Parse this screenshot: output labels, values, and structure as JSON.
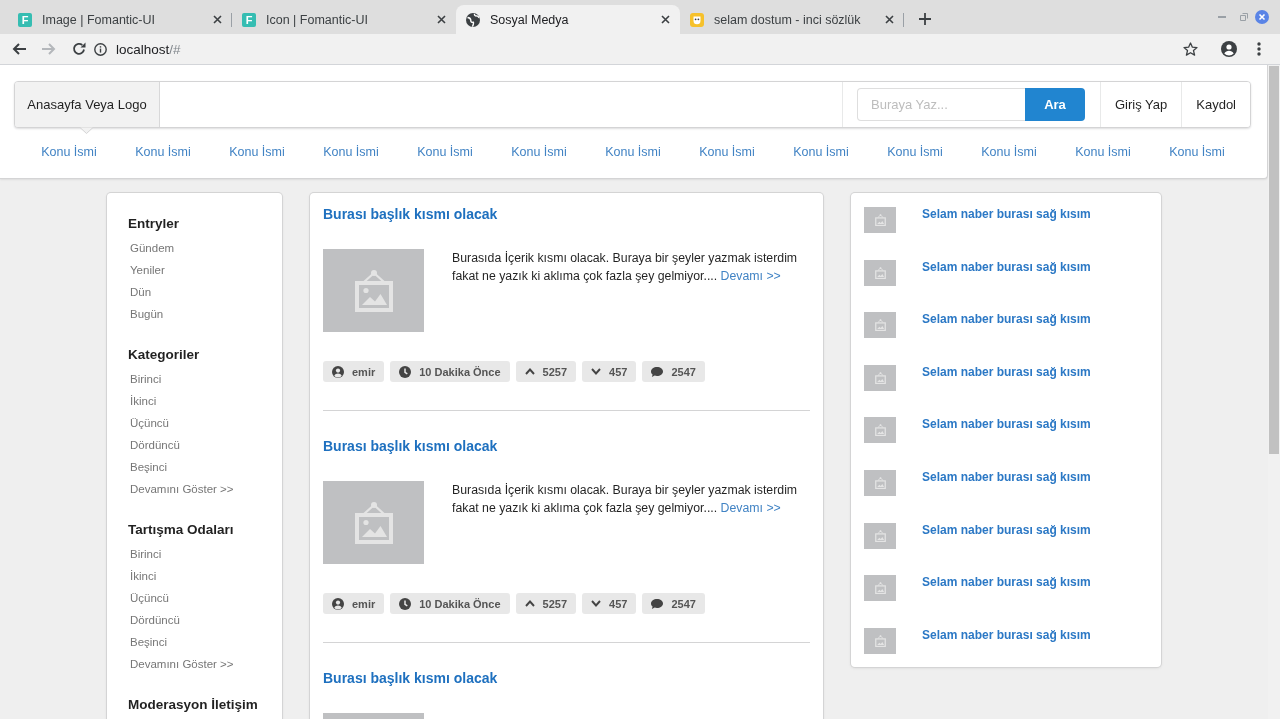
{
  "browser": {
    "tabs": [
      {
        "title": "Image | Fomantic-UI",
        "icon": {
          "kind": "letter",
          "text": "F"
        },
        "selected": false
      },
      {
        "title": "Icon | Fomantic-UI",
        "icon": {
          "kind": "letter",
          "text": "F"
        },
        "selected": false
      },
      {
        "title": "Sosyal Medya",
        "icon": {
          "kind": "globe"
        },
        "selected": true
      },
      {
        "title": "selam dostum - inci sözlük",
        "icon": {
          "kind": "tile"
        },
        "selected": false
      }
    ],
    "toolbar": {
      "back": {
        "disabled": false
      },
      "forward": {
        "disabled": true
      },
      "address": {
        "host": "localhost",
        "path": "/#"
      }
    }
  },
  "menu": {
    "home": {
      "label": "Anasayfa Veya Logo",
      "selected": true
    },
    "search": {
      "placeholder": "Buraya Yaz...",
      "button": "Ara"
    },
    "items": [
      {
        "label": "Giriş Yap",
        "selected": false
      },
      {
        "label": "Kaydol",
        "selected": false
      }
    ]
  },
  "topics": [
    {
      "label": "Konu İsmi"
    },
    {
      "label": "Konu İsmi"
    },
    {
      "label": "Konu İsmi"
    },
    {
      "label": "Konu İsmi"
    },
    {
      "label": "Konu İsmi"
    },
    {
      "label": "Konu İsmi"
    },
    {
      "label": "Konu İsmi"
    },
    {
      "label": "Konu İsmi"
    },
    {
      "label": "Konu İsmi"
    },
    {
      "label": "Konu İsmi"
    },
    {
      "label": "Konu İsmi"
    },
    {
      "label": "Konu İsmi"
    },
    {
      "label": "Konu İsmi"
    }
  ],
  "sidebar": {
    "sections": [
      {
        "title": "Entryler",
        "items": [
          "Gündem",
          "Yeniler",
          "Dün",
          "Bugün"
        ]
      },
      {
        "title": "Kategoriler",
        "items": [
          "Birinci",
          "İkinci",
          "Üçüncü",
          "Dördüncü",
          "Beşinci",
          "Devamını Göster >>"
        ]
      },
      {
        "title": "Tartışma Odaları",
        "items": [
          "Birinci",
          "İkinci",
          "Üçüncü",
          "Dördüncü",
          "Beşinci",
          "Devamını Göster >>"
        ]
      },
      {
        "title": "Moderasyon İletişim"
      }
    ]
  },
  "posts": [
    {
      "title": "Burası başlık kısmı olacak",
      "body": "Burasıda İçerik kısmı olacak. Buraya bir şeyler yazmak isterdim fakat ne yazık ki aklıma çok fazla şey gelmiyor....",
      "more": "Devamı >>",
      "meta": [
        {
          "kind": "author",
          "text": "emir"
        },
        {
          "kind": "time",
          "text": "10 Dakika Önce"
        },
        {
          "kind": "upvotes",
          "text": "5257"
        },
        {
          "kind": "downvotes",
          "text": "457"
        },
        {
          "kind": "comments",
          "text": "2547"
        }
      ]
    },
    {
      "title": "Burası başlık kısmı olacak",
      "body": "Burasıda İçerik kısmı olacak. Buraya bir şeyler yazmak isterdim fakat ne yazık ki aklıma çok fazla şey gelmiyor....",
      "more": "Devamı >>",
      "meta": [
        {
          "kind": "author",
          "text": "emir"
        },
        {
          "kind": "time",
          "text": "10 Dakika Önce"
        },
        {
          "kind": "upvotes",
          "text": "5257"
        },
        {
          "kind": "downvotes",
          "text": "457"
        },
        {
          "kind": "comments",
          "text": "2547"
        }
      ]
    },
    {
      "title": "Burası başlık kısmı olacak"
    }
  ],
  "right_panel": {
    "items": [
      {
        "title": "Selam naber burası sağ kısım"
      },
      {
        "title": "Selam naber burası sağ kısım"
      },
      {
        "title": "Selam naber burası sağ kısım"
      },
      {
        "title": "Selam naber burası sağ kısım"
      },
      {
        "title": "Selam naber burası sağ kısım"
      },
      {
        "title": "Selam naber burası sağ kısım"
      },
      {
        "title": "Selam naber burası sağ kısım"
      },
      {
        "title": "Selam naber burası sağ kısım"
      },
      {
        "title": "Selam naber burası sağ kısım"
      }
    ]
  }
}
